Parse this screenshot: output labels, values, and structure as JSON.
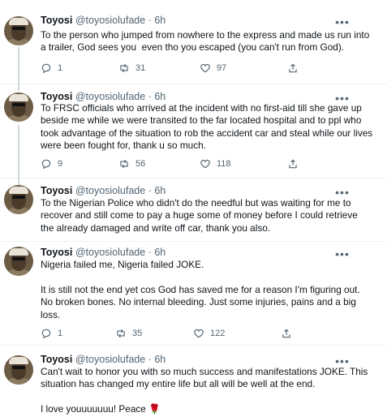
{
  "tweets": [
    {
      "name": "Toyosi",
      "handle": "@toyosiolufade",
      "time": "6h",
      "text": "To the person who jumped from nowhere to the express and made us run into a trailer, God sees you  even tho you escaped (you can't run from God).",
      "replies": "1",
      "retweets": "31",
      "likes": "97"
    },
    {
      "name": "Toyosi",
      "handle": "@toyosiolufade",
      "time": "6h",
      "text": "To FRSC officials who arrived at the incident with no first-aid till she gave up beside me while we were transited to the far located hospital and to ppl who took advantage of the situation to rob the accident car and steal while our lives were been fought for, thank u so much.",
      "replies": "9",
      "retweets": "56",
      "likes": "118"
    },
    {
      "name": "Toyosi",
      "handle": "@toyosiolufade",
      "time": "6h",
      "text": "To the Nigerian Police who didn't do the needful but was waiting for me to recover and still come to pay a huge some of money before I could retrieve the already damaged and write off car, thank you also."
    },
    {
      "name": "Toyosi",
      "handle": "@toyosiolufade",
      "time": "6h",
      "text": "Nigeria failed me, Nigeria failed JOKE.\n\nIt is still not the end yet cos God has saved me for a reason I'm figuring out. No broken bones. No internal bleeding. Just some injuries, pains and a big loss.",
      "replies": "1",
      "retweets": "35",
      "likes": "122"
    },
    {
      "name": "Toyosi",
      "handle": "@toyosiolufade",
      "time": "6h",
      "text": "Can't wait to honor you with so much success and manifestations JOKE. This situation has changed my entire life but all will be well at the end.\n\nI love youuuuuuu! Peace",
      "emoji": "🌹"
    }
  ],
  "ui": {
    "separator": "·",
    "more_glyph": "•••"
  },
  "colors": {
    "text": "#0f1419",
    "secondary": "#536471",
    "divider": "#eff3f4",
    "thread_line": "#cfd9de"
  }
}
